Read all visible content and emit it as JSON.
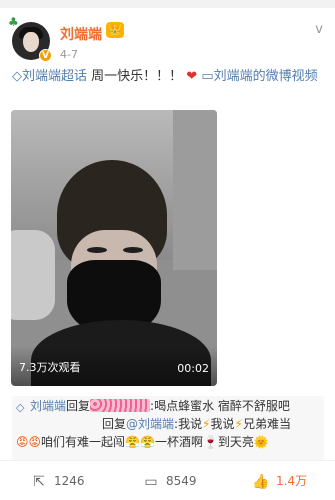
{
  "post": {
    "username": "刘端端",
    "crown_badge": "👑",
    "verified_badge": "V",
    "date": "4-7",
    "more": "v",
    "topic_link": "◇刘端端超话",
    "text": " 周一快乐！！！",
    "heart": "❤",
    "video_link": " ▭刘端端的微博视频"
  },
  "video": {
    "views": "7.3万次观看",
    "duration": "00:02"
  },
  "comment": {
    "icon": "◇",
    "author": "刘端端",
    "reply_word": "回复",
    "text_1": ":喝点蜂蜜水 宿醉不舒服吧",
    "reply_prefix": "回复",
    "reply_target": "@刘端端",
    "text_2a": ":我说",
    "bolt": "⚡",
    "text_2b": "我说",
    "text_2c": "兄弟难当",
    "emoji_angry": "😡😡",
    "text_3a": "咱们有难一起闯",
    "emoji_tired": "😤😤",
    "text_3b": "一杯酒啊",
    "emoji_wine": "🍷",
    "text_3c": "到天亮",
    "emoji_sun": "🌞"
  },
  "actions": {
    "repost_count": "1246",
    "comment_count": "8549",
    "like_count": "1.4万"
  },
  "colors": {
    "name": "#f46c2d",
    "link": "#507daf",
    "like": "#f46c2d"
  }
}
